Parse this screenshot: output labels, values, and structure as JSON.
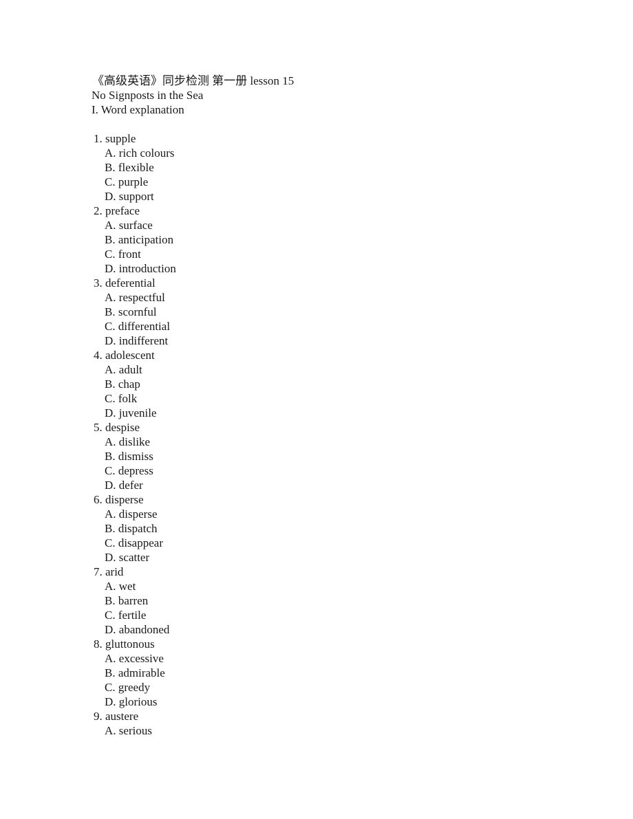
{
  "document": {
    "title_line": "《高级英语》同步检测 第一册 lesson 15",
    "title_cjk_1": "《高级英语》",
    "title_cjk_2": "同步检测",
    "title_cjk_3": "第一册",
    "title_latin": "lesson 15",
    "subtitle": "No Signposts in the Sea",
    "section_heading": "I. Word explanation"
  },
  "questions": [
    {
      "stem": "1. supple",
      "options": [
        "A. rich colours",
        "B. flexible",
        "C. purple",
        "D. support"
      ]
    },
    {
      "stem": "2. preface",
      "options": [
        "A. surface",
        "B. anticipation",
        "C. front",
        "D. introduction"
      ]
    },
    {
      "stem": "3. deferential",
      "options": [
        "A. respectful",
        "B. scornful",
        "C. differential",
        "D. indifferent"
      ]
    },
    {
      "stem": "4. adolescent",
      "options": [
        "A. adult",
        "B. chap",
        "C. folk",
        "D. juvenile"
      ]
    },
    {
      "stem": "5. despise",
      "options": [
        "A. dislike",
        "B. dismiss",
        "C. depress",
        "D. defer"
      ]
    },
    {
      "stem": "6. disperse",
      "options": [
        "A. disperse",
        "B. dispatch",
        "C. disappear",
        "D. scatter"
      ]
    },
    {
      "stem": "7. arid",
      "options": [
        "A. wet",
        "B. barren",
        "C. fertile",
        "D. abandoned"
      ]
    },
    {
      "stem": "8. gluttonous",
      "options": [
        "A. excessive",
        "B. admirable",
        "C. greedy",
        "D. glorious"
      ]
    },
    {
      "stem": "9. austere",
      "options": [
        "A. serious"
      ]
    }
  ],
  "colors": {
    "page_background": "#ffffff",
    "text": "#1a1a1a"
  }
}
